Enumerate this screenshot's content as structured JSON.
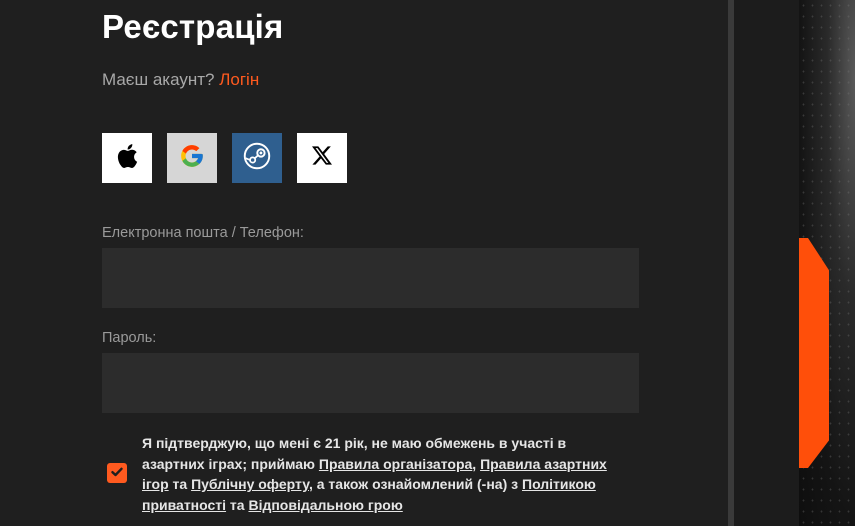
{
  "form": {
    "title": "Реєстрація",
    "have_account_text": "Маєш акаунт?",
    "login_link": "Логін",
    "social": [
      {
        "name": "apple",
        "icon": "apple-icon"
      },
      {
        "name": "google",
        "icon": "google-icon"
      },
      {
        "name": "steam",
        "icon": "steam-icon"
      },
      {
        "name": "x",
        "icon": "x-icon"
      }
    ],
    "email_label": "Електронна пошта / Телефон:",
    "email_value": "",
    "email_placeholder": "",
    "password_label": "Пароль:",
    "password_value": "",
    "password_placeholder": "",
    "consent": {
      "checked": true,
      "part1": "Я підтверджую, що мені є 21 рік, не маю обмежень в участі в азартних іграх; приймаю ",
      "link_organizer_rules": "Правила організатора",
      "part2": ", ",
      "link_gambling_rules": "Правила азартних ігор",
      "part3": " та ",
      "link_public_offer": "Публічну оферту",
      "part4": ", а також ознайомлений (-на) з ",
      "link_privacy_policy": "Політикою приватності",
      "part5": " та ",
      "link_responsible_gaming": "Відповідальною грою"
    }
  },
  "colors": {
    "accent": "#ff5a1f",
    "background": "#1f1f1f",
    "input_bg": "#2c2c2c",
    "steam_bg": "#2f5f8f",
    "banner_orange": "#ff4f0a"
  }
}
